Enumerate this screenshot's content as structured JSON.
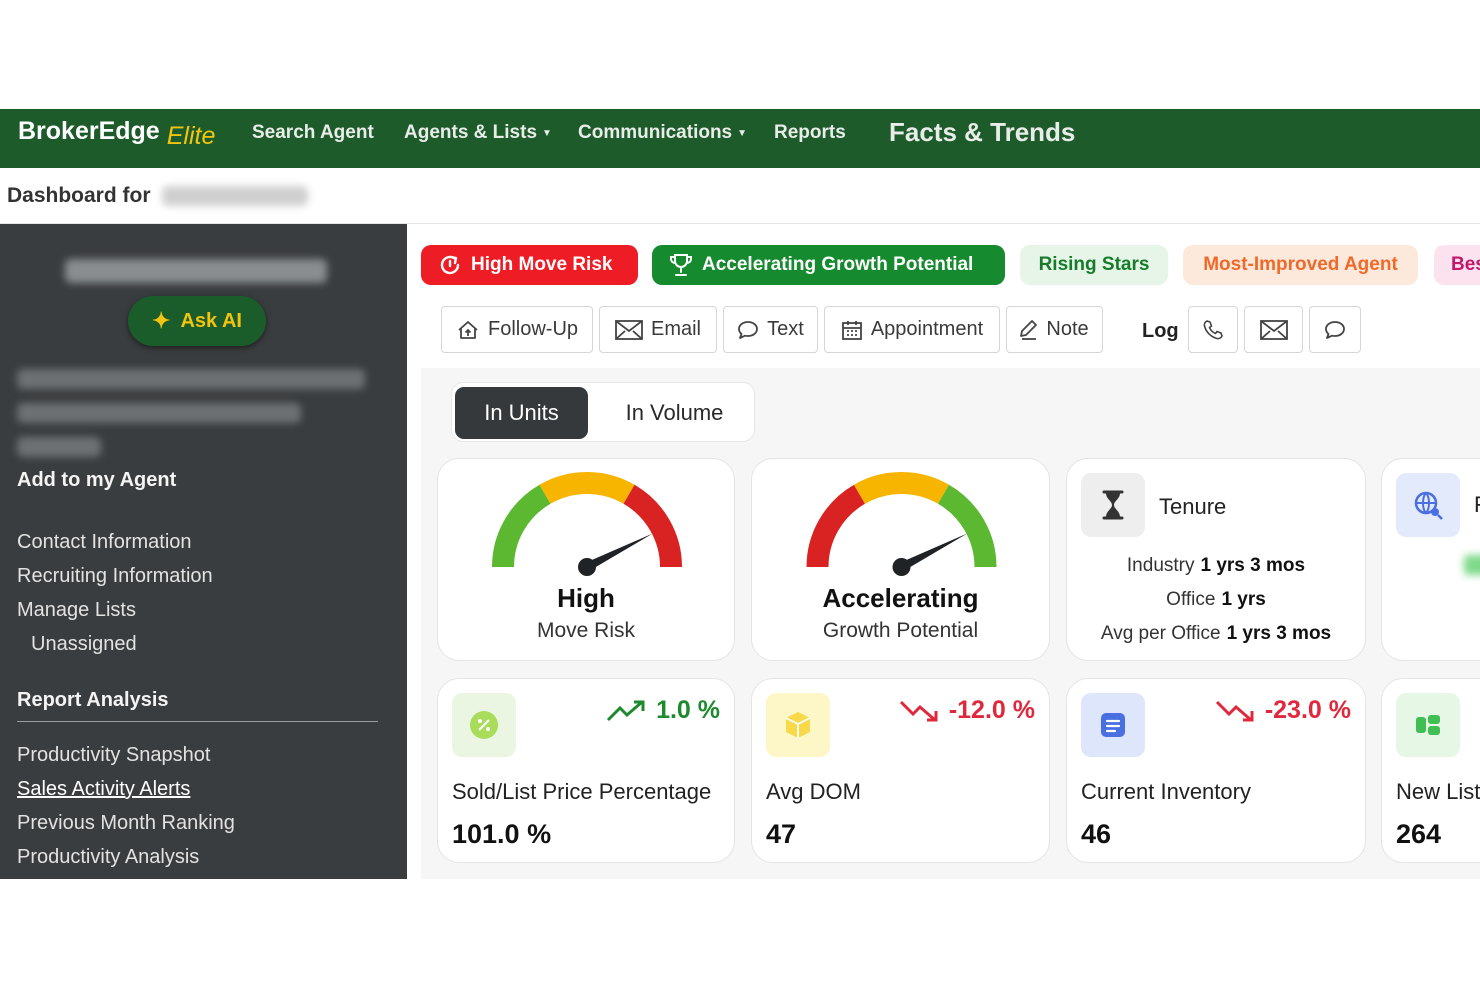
{
  "brand": {
    "name": "BrokerEdge",
    "suffix": "Elite"
  },
  "nav": {
    "search_agent": "Search Agent",
    "agents_lists": "Agents & Lists",
    "communications": "Communications",
    "reports": "Reports",
    "facts_trends": "Facts & Trends"
  },
  "dashboard": {
    "label": "Dashboard for"
  },
  "sidebar": {
    "ask_ai": "Ask AI",
    "add_to_agent": "Add to my Agent",
    "links": [
      "Contact Information",
      "Recruiting Information",
      "Manage Lists",
      "Unassigned"
    ],
    "report_heading": "Report Analysis",
    "reports": [
      "Productivity Snapshot",
      "Sales Activity Alerts",
      "Previous Month Ranking",
      "Productivity Analysis"
    ]
  },
  "tags": {
    "high_move_risk": "High Move Risk",
    "accelerating": "Accelerating Growth Potential",
    "rising_stars": "Rising Stars",
    "most_improved": "Most-Improved Agent",
    "best": "Bes"
  },
  "actions": {
    "follow_up": "Follow-Up",
    "email": "Email",
    "text": "Text",
    "appointment": "Appointment",
    "note": "Note",
    "log": "Log"
  },
  "toggle": {
    "units": "In Units",
    "volume": "In Volume"
  },
  "gauges": [
    {
      "title": "High",
      "subtitle": "Move Risk",
      "needle": 0.85
    },
    {
      "title": "Accelerating",
      "subtitle": "Growth Potential",
      "needle": 0.85
    }
  ],
  "tenure": {
    "title": "Tenure",
    "rows": [
      {
        "label": "Industry",
        "value": "1 yrs 3 mos"
      },
      {
        "label": "Office",
        "value": "1 yrs"
      },
      {
        "label": "Avg per Office",
        "value": "1 yrs 3 mos"
      }
    ]
  },
  "partial_card": {
    "title_initial": "F"
  },
  "metrics": [
    {
      "label": "Sold/List Price Percentage",
      "value": "101.0 %",
      "change": "1.0 %",
      "direction": "up",
      "color": "#1e8a2e"
    },
    {
      "label": "Avg DOM",
      "value": "47",
      "change": "-12.0 %",
      "direction": "down",
      "color": "#e0283c"
    },
    {
      "label": "Current Inventory",
      "value": "46",
      "change": "-23.0 %",
      "direction": "down",
      "color": "#e0283c"
    },
    {
      "label": "New List",
      "value": "264"
    }
  ],
  "colors": {
    "nav_green": "#1e5b2a",
    "brand_yellow": "#f2c40f",
    "risk_red": "#ee1c24",
    "growth_green": "#158a2e"
  }
}
